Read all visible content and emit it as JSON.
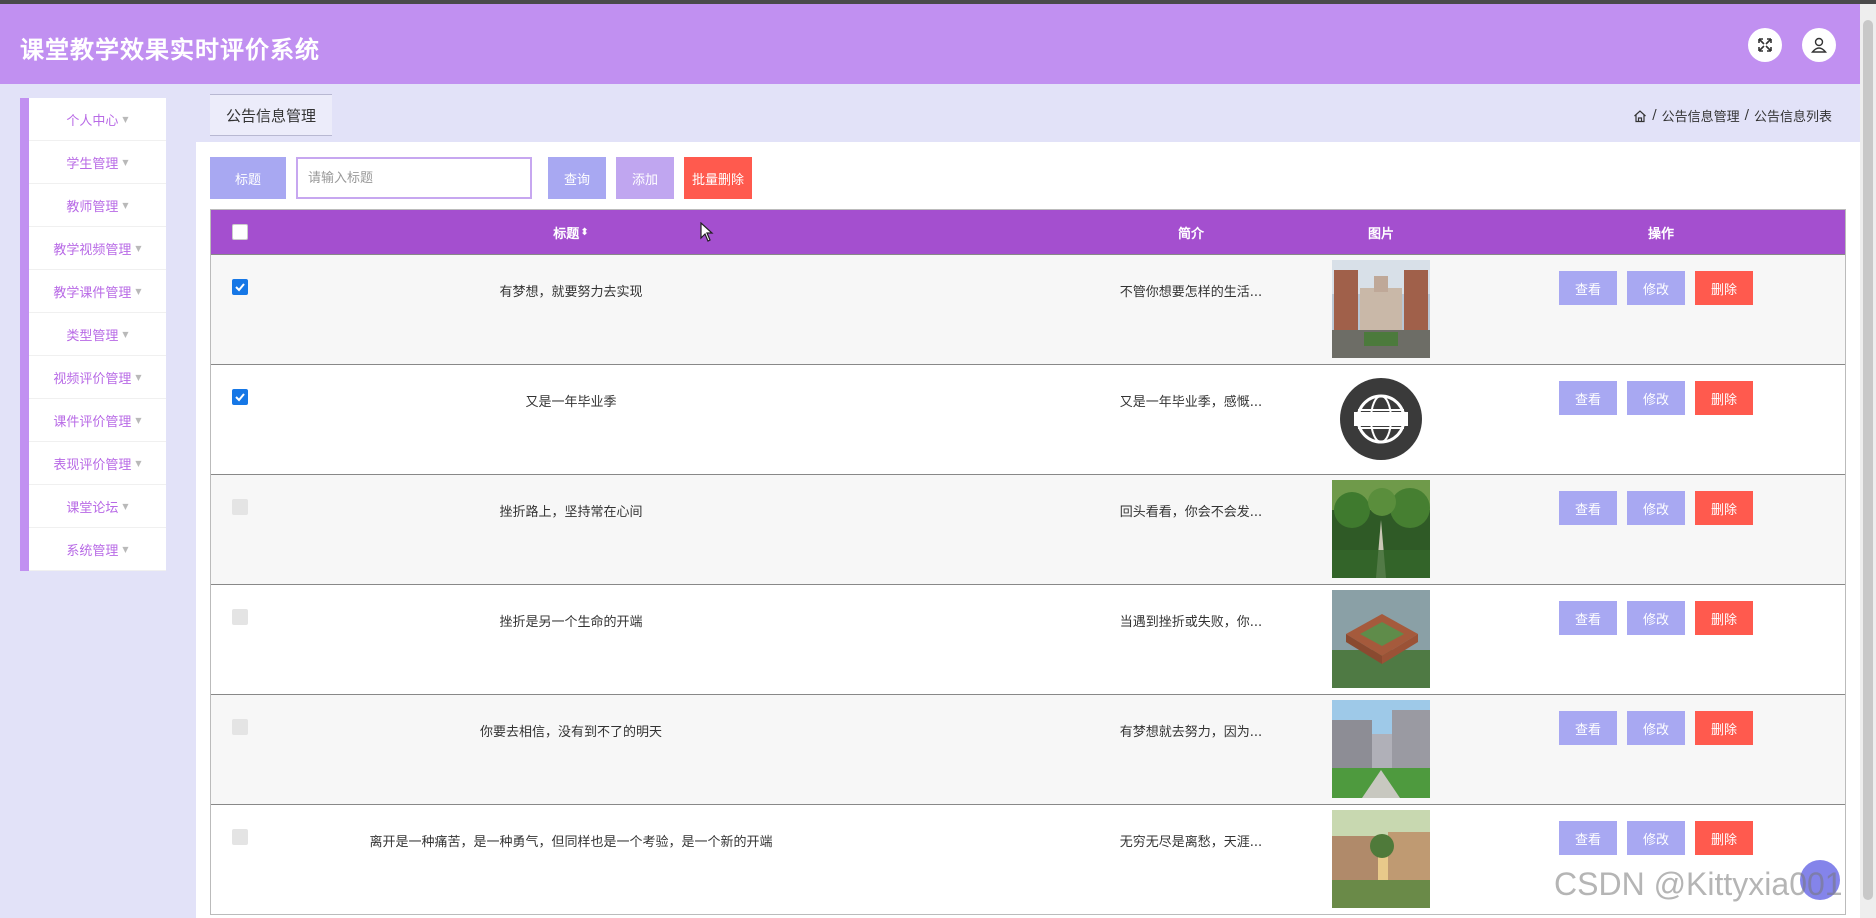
{
  "app": {
    "title": "课堂教学效果实时评价系统"
  },
  "header": {
    "fullscreen_icon": "expand-icon",
    "user_icon": "user-icon"
  },
  "sidebar": {
    "items": [
      {
        "label": "个人中心"
      },
      {
        "label": "学生管理"
      },
      {
        "label": "教师管理"
      },
      {
        "label": "教学视频管理"
      },
      {
        "label": "教学课件管理"
      },
      {
        "label": "类型管理"
      },
      {
        "label": "视频评价管理"
      },
      {
        "label": "课件评价管理"
      },
      {
        "label": "表现评价管理"
      },
      {
        "label": "课堂论坛"
      },
      {
        "label": "系统管理"
      }
    ]
  },
  "tab": {
    "label": "公告信息管理"
  },
  "breadcrumb": {
    "home_icon": "home-icon",
    "level1": "公告信息管理",
    "level2": "公告信息列表",
    "separator": "/"
  },
  "search": {
    "label": "标题",
    "placeholder": "请输入标题",
    "value": ""
  },
  "toolbar": {
    "query": "查询",
    "add": "添加",
    "batch_delete": "批量删除"
  },
  "table": {
    "columns": [
      "标题",
      "简介",
      "图片",
      "操作"
    ],
    "sort_icon": "sort-icon",
    "rows": [
      {
        "title": "有梦想，就要努力去实现",
        "intro": "不管你想要怎样的生活...",
        "image": "campus-building",
        "checked": true
      },
      {
        "title": "又是一年毕业季",
        "intro": "又是一年毕业季，感慨...",
        "image": "news-globe-logo",
        "checked": true
      },
      {
        "title": "挫折路上，坚持常在心间",
        "intro": "回头看看，你会不会发...",
        "image": "garden-path",
        "checked": false
      },
      {
        "title": "挫折是另一个生命的开端",
        "intro": "当遇到挫折或失败，你...",
        "image": "campus-aerial",
        "checked": false
      },
      {
        "title": "你要去相信，没有到不了的明天",
        "intro": "有梦想就去努力，因为...",
        "image": "campus-lawn",
        "checked": false
      },
      {
        "title": "离开是一种痛苦，是一种勇气，但同样也是一个考验，是一个新的开端",
        "intro": "无穷无尽是离愁，天涯...",
        "image": "campus-sunset",
        "checked": false
      }
    ],
    "actions": {
      "view": "查看",
      "edit": "修改",
      "delete": "删除"
    }
  },
  "watermark": "CSDN @Kittyxia001",
  "colors": {
    "header": "#c190f1",
    "sidebar_accent": "#c190f1",
    "table_header": "#a44fcf",
    "button_blue": "#a8a8f2",
    "button_red": "#ff5a4e",
    "checkbox_checked": "#1677e6"
  }
}
